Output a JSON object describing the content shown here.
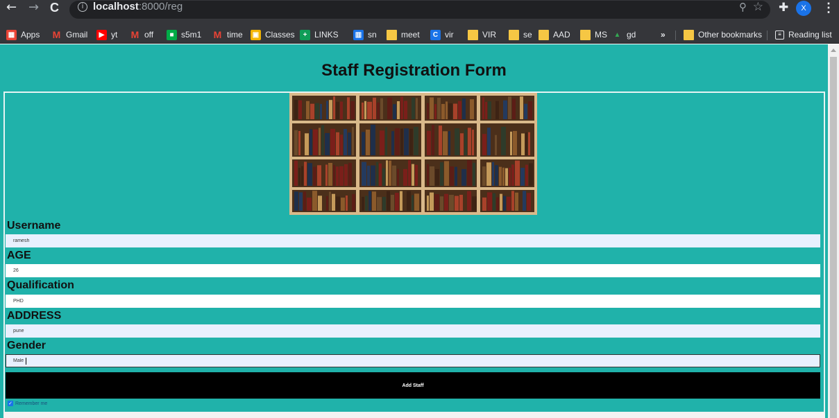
{
  "browser": {
    "url_host": "localhost",
    "url_path": ":8000/reg",
    "nav": {
      "back": "←",
      "forward": "→",
      "reload": "C"
    },
    "profile_initial": "X"
  },
  "bookmarks": [
    {
      "label": "Apps",
      "icon": "apps-grid-icon",
      "color": "#ea4335"
    },
    {
      "label": "Gmail",
      "icon": "gmail-icon",
      "color": "#ea4335"
    },
    {
      "label": "yt",
      "icon": "youtube-icon",
      "color": "#ff0000"
    },
    {
      "label": "off",
      "icon": "gmail-icon",
      "color": "#ea4335"
    },
    {
      "label": "s5m1",
      "icon": "meet-icon",
      "color": "#00ac47"
    },
    {
      "label": "time",
      "icon": "gmail-icon",
      "color": "#ea4335"
    },
    {
      "label": "Classes",
      "icon": "classroom-icon",
      "color": "#f4b400"
    },
    {
      "label": "LINKS",
      "icon": "sheets-plus-icon",
      "color": "#0f9d58"
    },
    {
      "label": "sn",
      "icon": "calendar-icon",
      "color": "#1a73e8"
    },
    {
      "label": "meet",
      "icon": "folder-icon",
      "color": "#f6c744"
    },
    {
      "label": "vir",
      "icon": "chrome-c-icon",
      "color": "#1a73e8"
    },
    {
      "label": "VIR",
      "icon": "folder-icon",
      "color": "#f6c744"
    },
    {
      "label": "se",
      "icon": "folder-icon",
      "color": "#f6c744"
    },
    {
      "label": "AAD",
      "icon": "folder-icon",
      "color": "#f6c744"
    },
    {
      "label": "MS",
      "icon": "folder-icon",
      "color": "#f6c744"
    },
    {
      "label": "gd",
      "icon": "drive-icon",
      "color": "#34a853"
    }
  ],
  "bookmarks_overflow": "»",
  "other_bookmarks": "Other bookmarks",
  "reading_list": "Reading list",
  "page": {
    "title": "Staff Registration Form",
    "background": "#20b2aa"
  },
  "form": {
    "username": {
      "label": "Username",
      "value": "ramesh"
    },
    "age": {
      "label": "AGE",
      "value": "26"
    },
    "qualification": {
      "label": "Qualification",
      "value": "PHD"
    },
    "address": {
      "label": "ADDRESS",
      "value": "pune"
    },
    "gender": {
      "label": "Gender",
      "value": "Male"
    },
    "submit_label": "Add Staff",
    "remember_label": "Remember me",
    "remember_checked": true
  }
}
